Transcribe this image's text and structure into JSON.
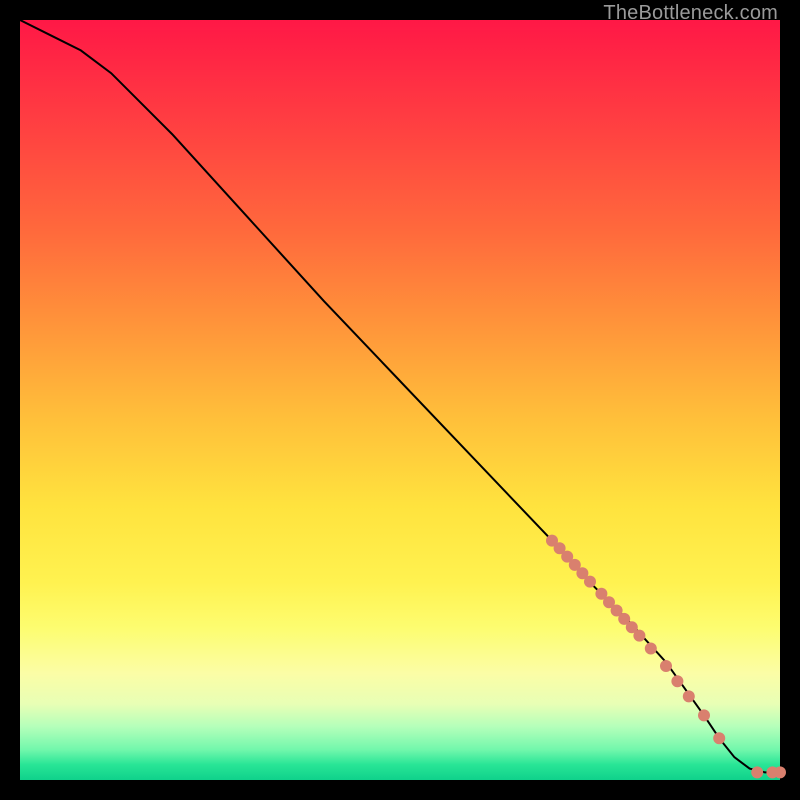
{
  "watermark": "TheBottleneck.com",
  "chart_data": {
    "type": "line",
    "title": "",
    "xlabel": "",
    "ylabel": "",
    "xlim": [
      0,
      100
    ],
    "ylim": [
      0,
      100
    ],
    "grid": false,
    "legend": false,
    "series": [
      {
        "name": "curve",
        "stroke": "#000000",
        "x": [
          0,
          4,
          8,
          12,
          20,
          30,
          40,
          50,
          60,
          70,
          75,
          80,
          85,
          90,
          92,
          94,
          96,
          98,
          100
        ],
        "y": [
          100,
          98,
          96,
          93,
          85,
          74,
          63,
          52.5,
          42,
          31.5,
          26,
          21,
          15.5,
          8.5,
          5.5,
          3,
          1.5,
          1,
          1
        ]
      }
    ],
    "markers": {
      "name": "highlight-points",
      "color": "#d9806e",
      "radius_px": 6,
      "points": [
        {
          "x": 70,
          "y": 31.5
        },
        {
          "x": 71,
          "y": 30.5
        },
        {
          "x": 72,
          "y": 29.4
        },
        {
          "x": 73,
          "y": 28.3
        },
        {
          "x": 74,
          "y": 27.2
        },
        {
          "x": 75,
          "y": 26.1
        },
        {
          "x": 76.5,
          "y": 24.5
        },
        {
          "x": 77.5,
          "y": 23.4
        },
        {
          "x": 78.5,
          "y": 22.3
        },
        {
          "x": 79.5,
          "y": 21.2
        },
        {
          "x": 80.5,
          "y": 20.1
        },
        {
          "x": 81.5,
          "y": 19.0
        },
        {
          "x": 83,
          "y": 17.3
        },
        {
          "x": 85,
          "y": 15.0
        },
        {
          "x": 86.5,
          "y": 13.0
        },
        {
          "x": 88,
          "y": 11.0
        },
        {
          "x": 90,
          "y": 8.5
        },
        {
          "x": 92,
          "y": 5.5
        },
        {
          "x": 97,
          "y": 1.0
        },
        {
          "x": 99,
          "y": 1.0
        },
        {
          "x": 100,
          "y": 1.0
        }
      ]
    }
  }
}
